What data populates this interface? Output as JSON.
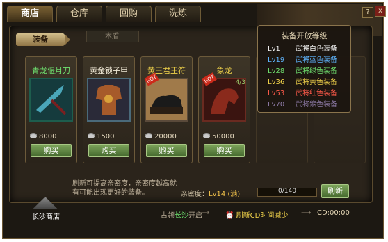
{
  "tabs": [
    "商店",
    "仓库",
    "回购",
    "洗炼"
  ],
  "window": {
    "help_label": "?",
    "close_label": "x"
  },
  "equip_tag": "装备",
  "seal_label": "木盾",
  "items": [
    {
      "name": "青龙偃月刀",
      "name_color": "#6fe06f",
      "price": "8000",
      "buy": "购买",
      "hot": false,
      "stock": "",
      "img": "#1f5e6a"
    },
    {
      "name": "黄金锁子甲",
      "name_color": "#f1ead7",
      "price": "1500",
      "buy": "购买",
      "hot": false,
      "stock": "",
      "img": "#7a4a22"
    },
    {
      "name": "黄王君王符",
      "name_color": "#f0d24a",
      "price": "20000",
      "buy": "购买",
      "hot": true,
      "stock": "",
      "img": "#3a2b1c"
    },
    {
      "name": "象龙",
      "name_color": "#f0d24a",
      "price": "50000",
      "buy": "购买",
      "hot": true,
      "stock": "4/3",
      "img": "#6a1f1a"
    }
  ],
  "popup": {
    "title": "装备开放等级",
    "rows": [
      {
        "lv": "Lv1",
        "txt": "武将白色装备",
        "color": "#f0f0f0"
      },
      {
        "lv": "Lv19",
        "txt": "武将蓝色装备",
        "color": "#5fb6ff"
      },
      {
        "lv": "Lv28",
        "txt": "武将绿色装备",
        "color": "#6fe06f"
      },
      {
        "lv": "Lv36",
        "txt": "武将黄色装备",
        "color": "#f0d24a"
      },
      {
        "lv": "Lv53",
        "txt": "武将红色装备",
        "color": "#ff5a4a"
      },
      {
        "lv": "Lv70",
        "txt": "武将紫色装备",
        "color": "#8d7aa6"
      }
    ]
  },
  "hint": "刷新可提高亲密度，亲密度越高就有可能出现更好的装备。",
  "affinity": {
    "label": "亲密度：",
    "value": "Lv14 (满)",
    "progress": "0/140",
    "progress_fraction": 0
  },
  "refresh": "刷新",
  "shop": {
    "label": "长沙商店"
  },
  "bottom": {
    "occupy_pre": "占领",
    "occupy_city": "长沙",
    "occupy_post": "开启",
    "cd_reduce": "刷新CD时间减少",
    "cd_time": "CD:00:00"
  }
}
